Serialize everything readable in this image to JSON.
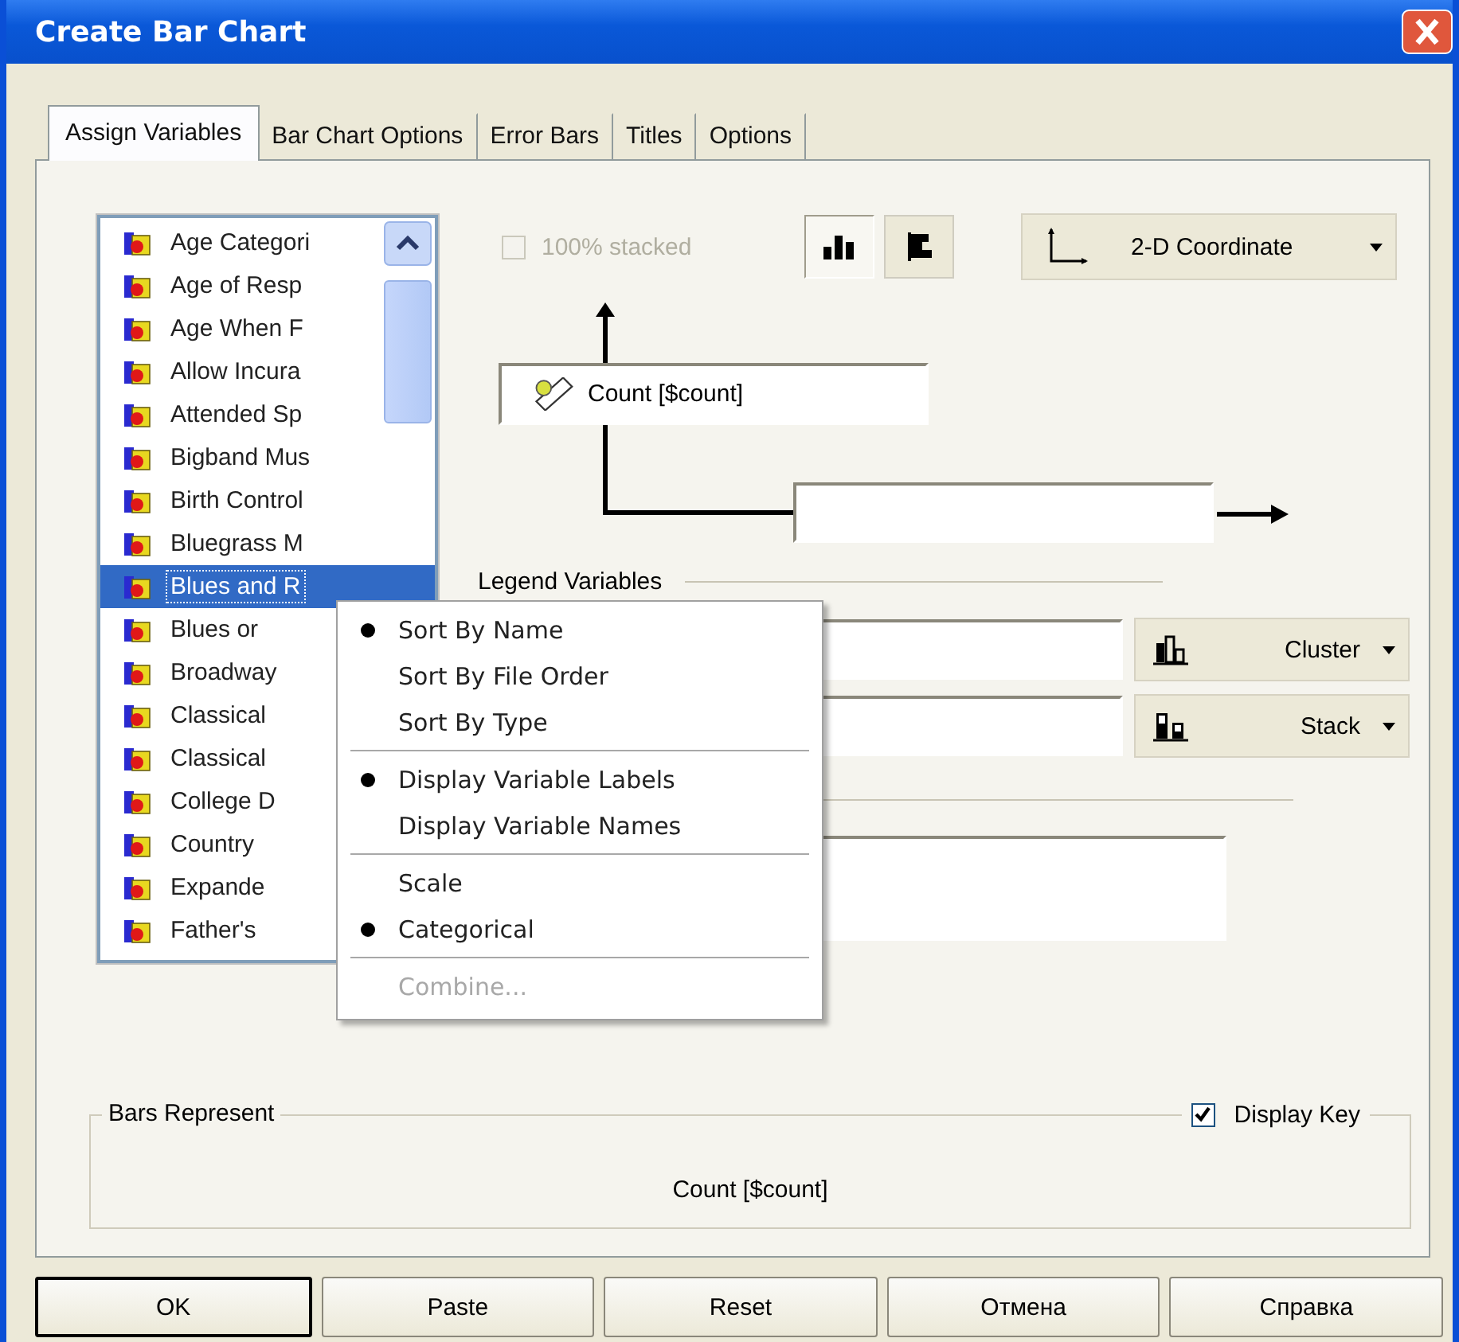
{
  "window": {
    "title": "Create Bar Chart"
  },
  "tabs": [
    {
      "label": "Assign Variables",
      "selected": true
    },
    {
      "label": "Bar Chart Options",
      "selected": false
    },
    {
      "label": "Error Bars",
      "selected": false
    },
    {
      "label": "Titles",
      "selected": false
    },
    {
      "label": "Options",
      "selected": false
    }
  ],
  "variables": [
    {
      "label": "Age Categori",
      "selected": false
    },
    {
      "label": "Age of Resp",
      "selected": false
    },
    {
      "label": "Age When F",
      "selected": false
    },
    {
      "label": "Allow Incura",
      "selected": false
    },
    {
      "label": "Attended Sp",
      "selected": false
    },
    {
      "label": "Bigband Mus",
      "selected": false
    },
    {
      "label": "Birth Control",
      "selected": false
    },
    {
      "label": "Bluegrass M",
      "selected": false
    },
    {
      "label": "Blues and R",
      "selected": true
    },
    {
      "label": "Blues or",
      "selected": false
    },
    {
      "label": "Broadway",
      "selected": false
    },
    {
      "label": "Classical",
      "selected": false
    },
    {
      "label": "Classical",
      "selected": false
    },
    {
      "label": "College D",
      "selected": false
    },
    {
      "label": "Country",
      "selected": false
    },
    {
      "label": "Expande",
      "selected": false
    },
    {
      "label": "Father's",
      "selected": false
    }
  ],
  "stacked_option": {
    "label": "100% stacked",
    "checked": false,
    "disabled": true
  },
  "orientation_buttons": [
    {
      "kind": "vertical",
      "selected": true
    },
    {
      "kind": "horizontal",
      "selected": false
    }
  ],
  "coordinate_dropdown": {
    "label": "2-D Coordinate"
  },
  "y_axis_zone": {
    "value": "Count [$count]"
  },
  "legend": {
    "title": "Legend Variables",
    "slots": [
      {
        "kind": "cluster",
        "button": "Cluster"
      },
      {
        "kind": "stack",
        "button": "Stack"
      }
    ]
  },
  "bars_represent": {
    "title": "Bars Represent",
    "value": "Count [$count]",
    "display_key": {
      "label": "Display Key",
      "checked": true
    }
  },
  "context_menu": {
    "groups": [
      {
        "items": [
          {
            "label": "Sort By Name",
            "selected": true,
            "disabled": false
          },
          {
            "label": "Sort By File Order",
            "selected": false,
            "disabled": false
          },
          {
            "label": "Sort By Type",
            "selected": false,
            "disabled": false
          }
        ]
      },
      {
        "items": [
          {
            "label": "Display Variable Labels",
            "selected": true,
            "disabled": false
          },
          {
            "label": "Display Variable Names",
            "selected": false,
            "disabled": false
          }
        ]
      },
      {
        "items": [
          {
            "label": "Scale",
            "selected": false,
            "disabled": false
          },
          {
            "label": "Categorical",
            "selected": true,
            "disabled": false
          }
        ]
      },
      {
        "items": [
          {
            "label": "Combine...",
            "selected": false,
            "disabled": true
          }
        ]
      }
    ]
  },
  "buttons": [
    {
      "label": "OK",
      "default": true
    },
    {
      "label": "Paste",
      "default": false
    },
    {
      "label": "Reset",
      "default": false
    },
    {
      "label": "Отмена",
      "default": false
    },
    {
      "label": "Справка",
      "default": false
    }
  ]
}
